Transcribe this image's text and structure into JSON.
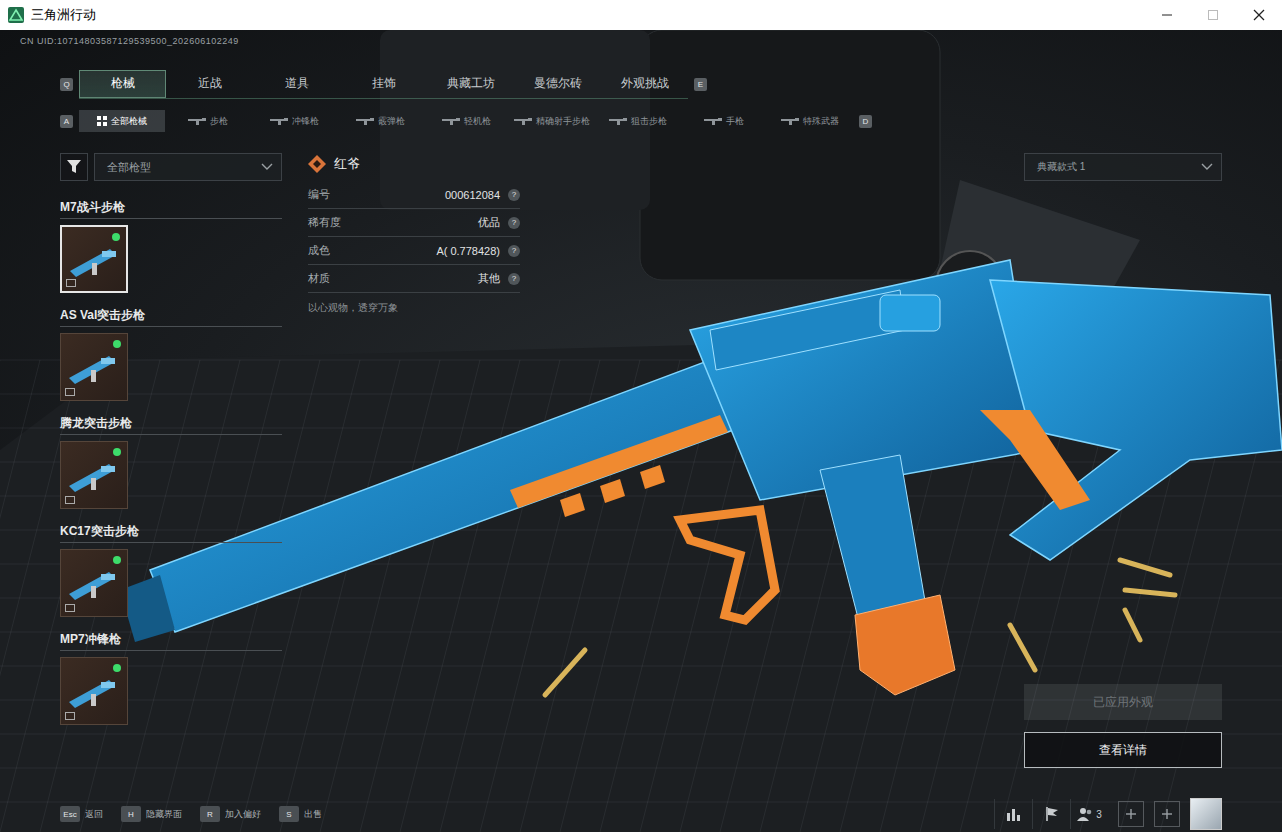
{
  "window": {
    "title": "三角洲行动"
  },
  "uid": "CN UID:10714803587129539500_202606102249",
  "top_tabs": {
    "prev_key": "Q",
    "next_key": "E",
    "items": [
      {
        "label": "枪械",
        "selected": true
      },
      {
        "label": "近战",
        "selected": false
      },
      {
        "label": "道具",
        "selected": false
      },
      {
        "label": "挂饰",
        "selected": false
      },
      {
        "label": "典藏工坊",
        "selected": false
      },
      {
        "label": "曼德尔砖",
        "selected": false
      },
      {
        "label": "外观挑战",
        "selected": false
      }
    ]
  },
  "sub_tabs": {
    "prev_key": "A",
    "next_key": "D",
    "items": [
      {
        "label": "全部枪械",
        "selected": true
      },
      {
        "label": "步枪",
        "selected": false
      },
      {
        "label": "冲锋枪",
        "selected": false
      },
      {
        "label": "霰弹枪",
        "selected": false
      },
      {
        "label": "轻机枪",
        "selected": false
      },
      {
        "label": "精确射手步枪",
        "selected": false
      },
      {
        "label": "狙击步枪",
        "selected": false
      },
      {
        "label": "手枪",
        "selected": false
      },
      {
        "label": "特殊武器",
        "selected": false
      }
    ]
  },
  "filter": {
    "value": "全部枪型"
  },
  "guns": [
    {
      "name": "M7战斗步枪",
      "selected": true,
      "equipped": true,
      "color": "#3ddc6a"
    },
    {
      "name": "AS Val突击步枪",
      "selected": false,
      "equipped": true,
      "color": "#3ddc6a"
    },
    {
      "name": "腾龙突击步枪",
      "selected": false,
      "equipped": true,
      "color": "#3ddc6a"
    },
    {
      "name": "KC17突击步枪",
      "selected": false,
      "equipped": true,
      "color": "#3ddc6a"
    },
    {
      "name": "MP7冲锋枪",
      "selected": false,
      "equipped": true,
      "color": "#3ddc6a"
    }
  ],
  "detail": {
    "title": "红爷",
    "rows": [
      {
        "label": "编号",
        "value": "000612084",
        "help": "?"
      },
      {
        "label": "稀有度",
        "value": "优品",
        "help": "?"
      },
      {
        "label": "成色",
        "value": "A( 0.778428)",
        "help": "?"
      },
      {
        "label": "材质",
        "value": "其他",
        "help": "?"
      }
    ],
    "description": "以心观物，透穿万象"
  },
  "style_select": {
    "value": "典藏款式 1"
  },
  "buttons": [
    {
      "label": "已应用外观",
      "disabled": true
    },
    {
      "label": "查看详情",
      "disabled": false
    }
  ],
  "hotkeys": [
    {
      "key": "Esc",
      "label": "返回"
    },
    {
      "key": "H",
      "label": "隐藏界面"
    },
    {
      "key": "R",
      "label": "加入偏好"
    },
    {
      "key": "S",
      "label": "出售"
    }
  ],
  "party": {
    "count": "3"
  }
}
